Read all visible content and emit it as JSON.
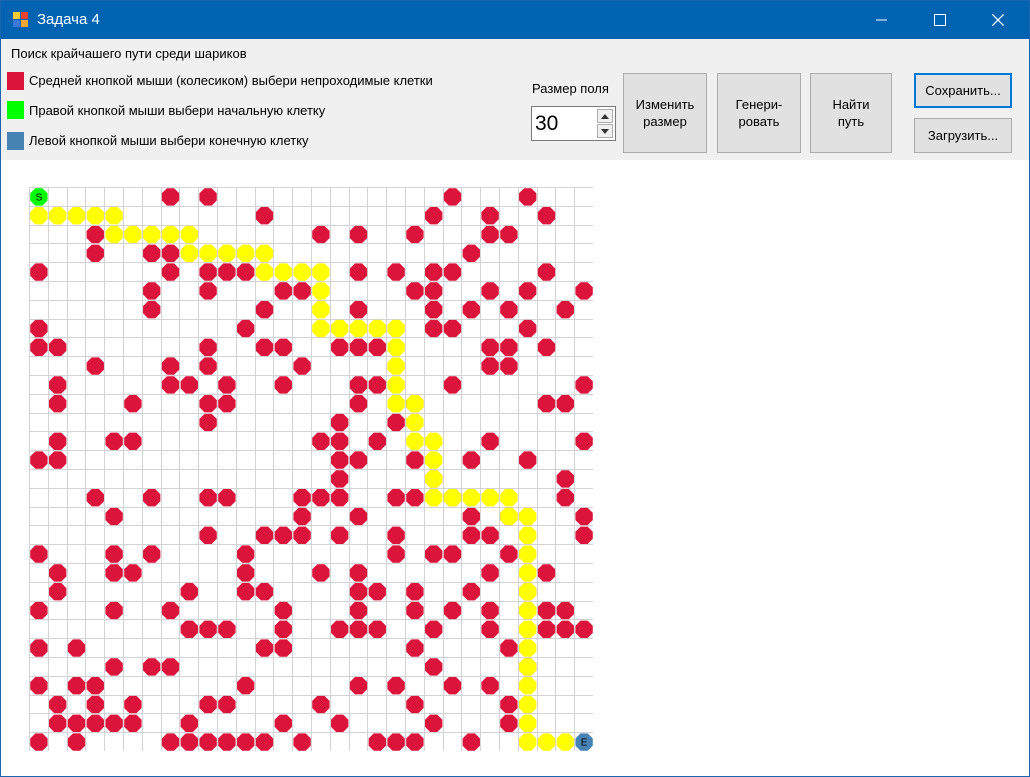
{
  "window": {
    "title": "Задача 4",
    "controls": {
      "minimize": "minimize-icon",
      "maximize": "maximize-icon",
      "close": "close-icon"
    }
  },
  "panel": {
    "heading": "Поиск крайчашего пути среди шариков",
    "legend": [
      {
        "color": "#dc143c",
        "text": "Средней кнопкой мыши (колесиком) выбери непроходимые клетки"
      },
      {
        "color": "#00ff00",
        "text": "Правой кнопкой мыши выбери начальную клетку"
      },
      {
        "color": "#4682b4",
        "text": "Левой кнопкой мыши выбери конечную клетку"
      }
    ],
    "size_label": "Размер поля",
    "size_value": "30",
    "buttons": {
      "resize": "Изменить\nразмер",
      "generate": "Генери-\nровать",
      "find": "Найти\nпуть",
      "save": "Сохранить...",
      "load": "Загрузить..."
    }
  },
  "grid": {
    "size": 30,
    "start_label": "S",
    "end_label": "E",
    "colors": {
      "obstacle": "#dc143c",
      "path": "#ffff00",
      "start": "#00ff00",
      "end": "#4682b4",
      "line": "#d3d3d3"
    },
    "start": [
      0,
      0
    ],
    "end": [
      29,
      29
    ],
    "obstacles": [
      [
        0,
        7
      ],
      [
        0,
        9
      ],
      [
        0,
        22
      ],
      [
        0,
        26
      ],
      [
        1,
        12
      ],
      [
        1,
        21
      ],
      [
        1,
        24
      ],
      [
        1,
        27
      ],
      [
        2,
        3
      ],
      [
        2,
        15
      ],
      [
        2,
        17
      ],
      [
        2,
        20
      ],
      [
        2,
        24
      ],
      [
        2,
        25
      ],
      [
        3,
        3
      ],
      [
        3,
        6
      ],
      [
        3,
        7
      ],
      [
        3,
        23
      ],
      [
        4,
        0
      ],
      [
        4,
        7
      ],
      [
        4,
        9
      ],
      [
        4,
        10
      ],
      [
        4,
        11
      ],
      [
        4,
        17
      ],
      [
        4,
        19
      ],
      [
        4,
        21
      ],
      [
        4,
        22
      ],
      [
        4,
        27
      ],
      [
        5,
        6
      ],
      [
        5,
        9
      ],
      [
        5,
        13
      ],
      [
        5,
        14
      ],
      [
        5,
        20
      ],
      [
        5,
        21
      ],
      [
        5,
        24
      ],
      [
        5,
        26
      ],
      [
        5,
        29
      ],
      [
        6,
        6
      ],
      [
        6,
        12
      ],
      [
        6,
        17
      ],
      [
        6,
        21
      ],
      [
        6,
        23
      ],
      [
        6,
        25
      ],
      [
        6,
        28
      ],
      [
        7,
        0
      ],
      [
        7,
        11
      ],
      [
        7,
        21
      ],
      [
        7,
        22
      ],
      [
        7,
        26
      ],
      [
        8,
        0
      ],
      [
        8,
        1
      ],
      [
        8,
        9
      ],
      [
        8,
        12
      ],
      [
        8,
        13
      ],
      [
        8,
        16
      ],
      [
        8,
        17
      ],
      [
        8,
        18
      ],
      [
        8,
        24
      ],
      [
        8,
        25
      ],
      [
        8,
        27
      ],
      [
        9,
        3
      ],
      [
        9,
        7
      ],
      [
        9,
        9
      ],
      [
        9,
        14
      ],
      [
        9,
        24
      ],
      [
        9,
        25
      ],
      [
        10,
        1
      ],
      [
        10,
        7
      ],
      [
        10,
        8
      ],
      [
        10,
        10
      ],
      [
        10,
        13
      ],
      [
        10,
        17
      ],
      [
        10,
        18
      ],
      [
        10,
        22
      ],
      [
        10,
        29
      ],
      [
        11,
        1
      ],
      [
        11,
        5
      ],
      [
        11,
        9
      ],
      [
        11,
        10
      ],
      [
        11,
        17
      ],
      [
        11,
        20
      ],
      [
        11,
        27
      ],
      [
        11,
        28
      ],
      [
        12,
        9
      ],
      [
        12,
        16
      ],
      [
        12,
        19
      ],
      [
        13,
        1
      ],
      [
        13,
        4
      ],
      [
        13,
        5
      ],
      [
        13,
        15
      ],
      [
        13,
        16
      ],
      [
        13,
        18
      ],
      [
        13,
        24
      ],
      [
        13,
        29
      ],
      [
        14,
        0
      ],
      [
        14,
        1
      ],
      [
        14,
        16
      ],
      [
        14,
        17
      ],
      [
        14,
        20
      ],
      [
        14,
        23
      ],
      [
        14,
        26
      ],
      [
        15,
        16
      ],
      [
        15,
        21
      ],
      [
        15,
        28
      ],
      [
        16,
        3
      ],
      [
        16,
        6
      ],
      [
        16,
        9
      ],
      [
        16,
        10
      ],
      [
        16,
        14
      ],
      [
        16,
        15
      ],
      [
        16,
        16
      ],
      [
        16,
        19
      ],
      [
        16,
        20
      ],
      [
        16,
        22
      ],
      [
        16,
        28
      ],
      [
        17,
        4
      ],
      [
        17,
        14
      ],
      [
        17,
        17
      ],
      [
        17,
        23
      ],
      [
        17,
        25
      ],
      [
        17,
        29
      ],
      [
        18,
        9
      ],
      [
        18,
        12
      ],
      [
        18,
        13
      ],
      [
        18,
        14
      ],
      [
        18,
        16
      ],
      [
        18,
        19
      ],
      [
        18,
        23
      ],
      [
        18,
        24
      ],
      [
        18,
        29
      ],
      [
        19,
        0
      ],
      [
        19,
        4
      ],
      [
        19,
        6
      ],
      [
        19,
        11
      ],
      [
        19,
        19
      ],
      [
        19,
        21
      ],
      [
        19,
        22
      ],
      [
        19,
        25
      ],
      [
        20,
        1
      ],
      [
        20,
        4
      ],
      [
        20,
        5
      ],
      [
        20,
        11
      ],
      [
        20,
        15
      ],
      [
        20,
        17
      ],
      [
        20,
        24
      ],
      [
        20,
        27
      ],
      [
        21,
        1
      ],
      [
        21,
        8
      ],
      [
        21,
        11
      ],
      [
        21,
        12
      ],
      [
        21,
        17
      ],
      [
        21,
        18
      ],
      [
        21,
        20
      ],
      [
        21,
        23
      ],
      [
        21,
        26
      ],
      [
        22,
        0
      ],
      [
        22,
        4
      ],
      [
        22,
        7
      ],
      [
        22,
        13
      ],
      [
        22,
        17
      ],
      [
        22,
        20
      ],
      [
        22,
        22
      ],
      [
        22,
        24
      ],
      [
        22,
        27
      ],
      [
        22,
        28
      ],
      [
        23,
        8
      ],
      [
        23,
        9
      ],
      [
        23,
        10
      ],
      [
        23,
        13
      ],
      [
        23,
        16
      ],
      [
        23,
        17
      ],
      [
        23,
        18
      ],
      [
        23,
        21
      ],
      [
        23,
        24
      ],
      [
        23,
        27
      ],
      [
        23,
        28
      ],
      [
        23,
        29
      ],
      [
        24,
        0
      ],
      [
        24,
        2
      ],
      [
        24,
        12
      ],
      [
        24,
        13
      ],
      [
        24,
        20
      ],
      [
        24,
        25
      ],
      [
        25,
        4
      ],
      [
        25,
        6
      ],
      [
        25,
        7
      ],
      [
        25,
        21
      ],
      [
        25,
        26
      ],
      [
        26,
        0
      ],
      [
        26,
        2
      ],
      [
        26,
        3
      ],
      [
        26,
        11
      ],
      [
        26,
        17
      ],
      [
        26,
        19
      ],
      [
        26,
        22
      ],
      [
        26,
        24
      ],
      [
        27,
        1
      ],
      [
        27,
        3
      ],
      [
        27,
        5
      ],
      [
        27,
        9
      ],
      [
        27,
        10
      ],
      [
        27,
        15
      ],
      [
        27,
        20
      ],
      [
        27,
        25
      ],
      [
        28,
        1
      ],
      [
        28,
        2
      ],
      [
        28,
        3
      ],
      [
        28,
        4
      ],
      [
        28,
        5
      ],
      [
        28,
        8
      ],
      [
        28,
        13
      ],
      [
        28,
        16
      ],
      [
        28,
        21
      ],
      [
        28,
        25
      ],
      [
        29,
        0
      ],
      [
        29,
        2
      ],
      [
        29,
        7
      ],
      [
        29,
        8
      ],
      [
        29,
        9
      ],
      [
        29,
        10
      ],
      [
        29,
        11
      ],
      [
        29,
        12
      ],
      [
        29,
        14
      ],
      [
        29,
        18
      ],
      [
        29,
        19
      ],
      [
        29,
        20
      ],
      [
        29,
        23
      ]
    ],
    "path": [
      [
        1,
        0
      ],
      [
        1,
        1
      ],
      [
        1,
        2
      ],
      [
        1,
        3
      ],
      [
        1,
        4
      ],
      [
        2,
        4
      ],
      [
        2,
        5
      ],
      [
        2,
        6
      ],
      [
        2,
        7
      ],
      [
        2,
        8
      ],
      [
        3,
        8
      ],
      [
        3,
        9
      ],
      [
        3,
        10
      ],
      [
        3,
        11
      ],
      [
        3,
        12
      ],
      [
        4,
        12
      ],
      [
        4,
        13
      ],
      [
        4,
        14
      ],
      [
        4,
        15
      ],
      [
        5,
        15
      ],
      [
        6,
        15
      ],
      [
        7,
        15
      ],
      [
        7,
        16
      ],
      [
        7,
        17
      ],
      [
        7,
        18
      ],
      [
        7,
        19
      ],
      [
        8,
        19
      ],
      [
        9,
        19
      ],
      [
        10,
        19
      ],
      [
        11,
        19
      ],
      [
        11,
        20
      ],
      [
        12,
        20
      ],
      [
        13,
        20
      ],
      [
        13,
        21
      ],
      [
        14,
        21
      ],
      [
        15,
        21
      ],
      [
        16,
        21
      ],
      [
        16,
        22
      ],
      [
        16,
        23
      ],
      [
        16,
        24
      ],
      [
        16,
        25
      ],
      [
        17,
        25
      ],
      [
        17,
        26
      ],
      [
        18,
        26
      ],
      [
        19,
        26
      ],
      [
        20,
        26
      ],
      [
        21,
        26
      ],
      [
        22,
        26
      ],
      [
        23,
        26
      ],
      [
        24,
        26
      ],
      [
        25,
        26
      ],
      [
        26,
        26
      ],
      [
        27,
        26
      ],
      [
        28,
        26
      ],
      [
        29,
        26
      ],
      [
        29,
        27
      ],
      [
        29,
        28
      ]
    ]
  }
}
